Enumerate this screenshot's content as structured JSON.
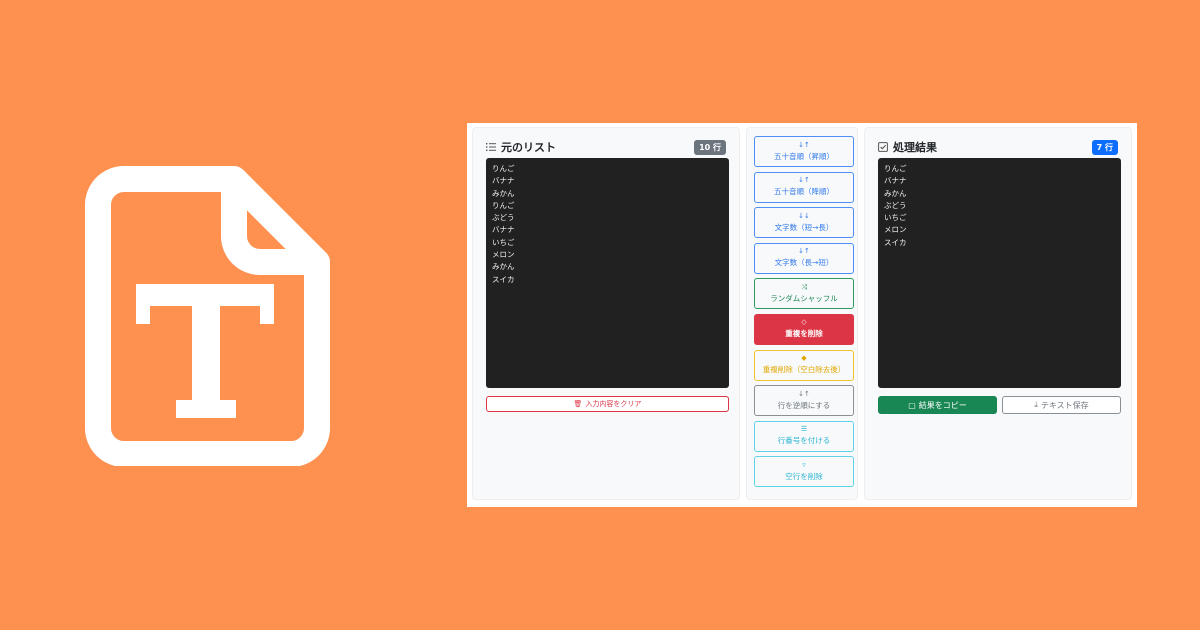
{
  "colors": {
    "background": "#ff9150",
    "panel": "#f8f9fa",
    "textarea": "#212121",
    "primary": "#0d6efd",
    "success": "#198754",
    "danger": "#dc3545",
    "warning": "#ffc107",
    "info": "#0dcaf0",
    "secondary": "#6c757d"
  },
  "logo": {
    "icon": "text-file-icon"
  },
  "left_panel": {
    "icon": "list-icon",
    "title": "元のリスト",
    "count_badge": "10 行",
    "lines": [
      "りんご",
      "バナナ",
      "みかん",
      "りんご",
      "ぶどう",
      "バナナ",
      "いちご",
      "メロン",
      "みかん",
      "スイカ"
    ],
    "clear_button": {
      "icon": "trash-icon",
      "label": "入力内容をクリア"
    }
  },
  "actions": [
    {
      "icon": "sort-asc-icon",
      "glyph": "↓↑",
      "label": "五十音順（昇順）",
      "style": "blue"
    },
    {
      "icon": "sort-desc-icon",
      "glyph": "↓↑",
      "label": "五十音順（降順）",
      "style": "blue"
    },
    {
      "icon": "sort-length-asc-icon",
      "glyph": "↓↓",
      "label": "文字数（短→長）",
      "style": "blue"
    },
    {
      "icon": "sort-length-desc-icon",
      "glyph": "↓↑",
      "label": "文字数（長→短）",
      "style": "blue"
    },
    {
      "icon": "shuffle-icon",
      "glyph": "⤨",
      "label": "ランダムシャッフル",
      "style": "green"
    },
    {
      "icon": "eraser-icon",
      "glyph": "◇",
      "label": "重複を削除",
      "style": "red"
    },
    {
      "icon": "eraser-fill-icon",
      "glyph": "◆",
      "label": "重複削除（空白除去後）",
      "style": "yellow"
    },
    {
      "icon": "reverse-icon",
      "glyph": "↓↑",
      "label": "行を逆順にする",
      "style": "gray"
    },
    {
      "icon": "numbered-list-icon",
      "glyph": "☰",
      "label": "行番号を付ける",
      "style": "cyan"
    },
    {
      "icon": "filter-icon",
      "glyph": "▿",
      "label": "空行を削除",
      "style": "cyan"
    }
  ],
  "right_panel": {
    "icon": "check-square-icon",
    "title": "処理結果",
    "count_badge": "7 行",
    "lines": [
      "りんご",
      "バナナ",
      "みかん",
      "ぶどう",
      "いちご",
      "メロン",
      "スイカ"
    ],
    "copy_button": {
      "icon": "clipboard-icon",
      "label": "結果をコピー"
    },
    "save_button": {
      "icon": "download-icon",
      "label": "テキスト保存"
    }
  }
}
